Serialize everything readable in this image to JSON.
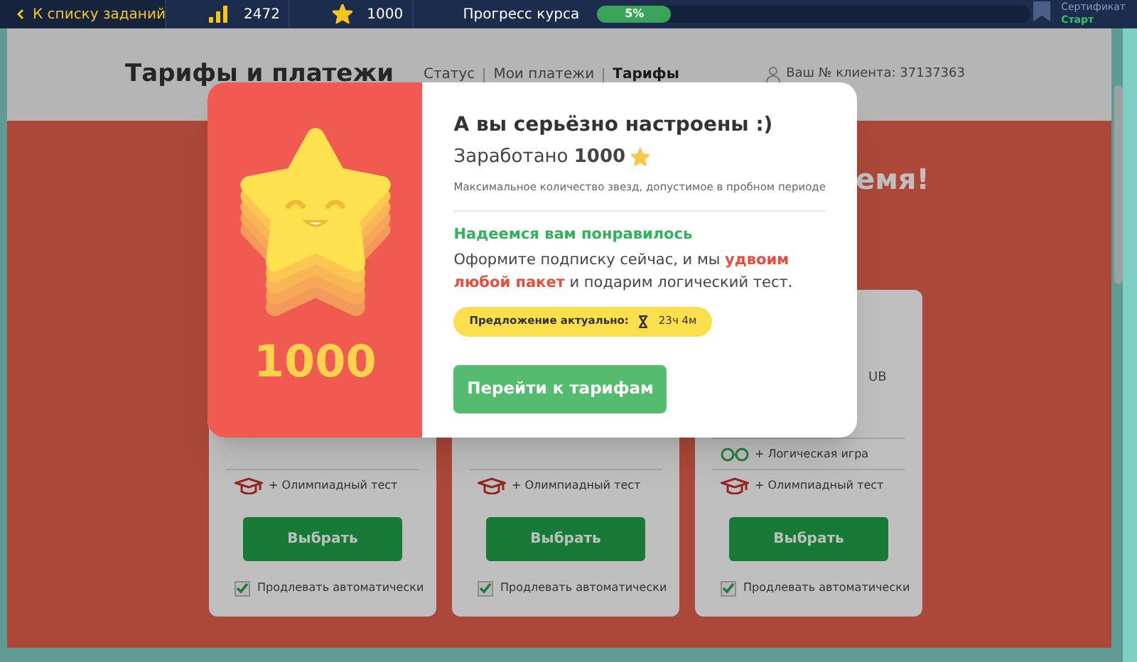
{
  "top_bar": {
    "back_link": "К списку заданий",
    "stats": [
      {
        "kind": "bars",
        "value": "2472"
      },
      {
        "kind": "star",
        "value": "1000"
      }
    ],
    "progress": {
      "label": "Прогресс курса",
      "reading": "5%"
    },
    "certificate": {
      "label": "Сертификат",
      "value": "Старт"
    }
  },
  "header": {
    "title": "Тарифы и платежи",
    "breadcrumbs": [
      {
        "label": "Статус",
        "selected": false
      },
      {
        "label": "Мои платежи",
        "selected": false
      },
      {
        "label": "Тарифы",
        "selected": true
      }
    ],
    "client": "Ваш № клиента: 37137363"
  },
  "banner": {
    "heading_fragment": "емя!"
  },
  "plans": [
    {
      "features": [
        {
          "kind": "olympiad",
          "text": "+ Олимпиадный тест"
        }
      ],
      "button": "Выбрать",
      "auto_renew": {
        "label": "Продлевать автоматически",
        "checked": true
      }
    },
    {
      "features": [
        {
          "kind": "olympiad",
          "text": "+ Олимпиадный тест"
        }
      ],
      "button": "Выбрать",
      "auto_renew": {
        "label": "Продлевать автоматически",
        "checked": true
      }
    },
    {
      "fragment": "UB",
      "features": [
        {
          "kind": "logic",
          "text": "+ Логическая игра"
        },
        {
          "kind": "olympiad",
          "text": "+ Олимпиадный тест"
        }
      ],
      "button": "Выбрать",
      "auto_renew": {
        "label": "Продлевать автоматически",
        "checked": true
      }
    }
  ],
  "modal": {
    "stars_count": "1000",
    "title": "А вы серьёзно настроены :)",
    "earned": "Заработано **1000**",
    "note": "Максимальное количество звезд, допустимое в пробном периоде",
    "subtitle": "Надеемся вам понравилось",
    "message": [
      {
        "text": "Оформите подписку сейчас, и мы ",
        "highlight": false
      },
      {
        "text": "удвоим любой пакет",
        "highlight": true
      },
      {
        "text": " и подарим логический тест.",
        "highlight": false
      }
    ],
    "offer": {
      "label": "Предложение актуально:",
      "time": "23ч 4м"
    },
    "button": "Перейти к тарифам"
  }
}
